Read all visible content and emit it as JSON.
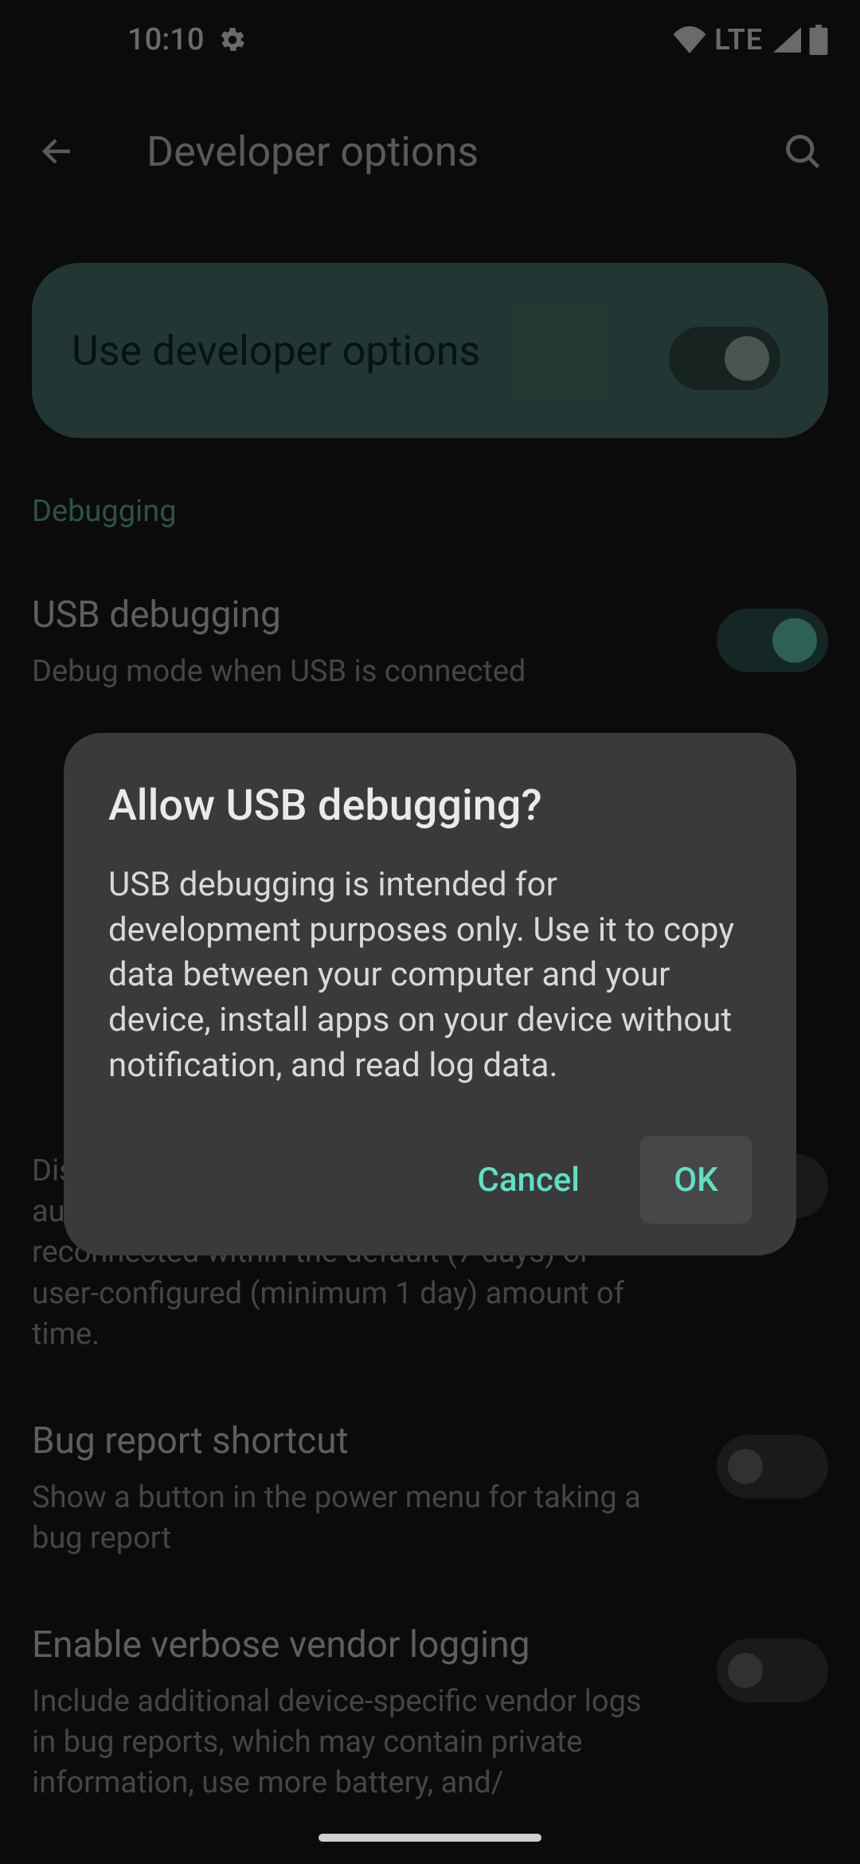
{
  "status": {
    "time": "10:10",
    "lte": "LTE"
  },
  "header": {
    "title": "Developer options"
  },
  "dev_card": {
    "label": "Use developer options",
    "toggle_on": true
  },
  "section": {
    "debugging": "Debugging"
  },
  "rows": {
    "usb_debugging": {
      "title": "USB debugging",
      "sub": "Debug mode when USB is connected",
      "toggle_on": true
    },
    "disable_adb_timeout": {
      "sub": "Disable automatic revocation of adb authorizations for systems that have not reconnected within the default (7 days) or user-configured (minimum 1 day) amount of time.",
      "toggle_on": false
    },
    "bug_report_shortcut": {
      "title": "Bug report shortcut",
      "sub": "Show a button in the power menu for taking a bug report",
      "toggle_on": false
    },
    "verbose_vendor_logging": {
      "title": "Enable verbose vendor logging",
      "sub": "Include additional device-specific vendor logs in bug reports, which may contain private information, use more battery, and/",
      "toggle_on": false
    }
  },
  "dialog": {
    "title": "Allow USB debugging?",
    "body": "USB debugging is intended for development purposes only. Use it to copy data between your computer and your device, install apps on your device without notification, and read log data.",
    "cancel": "Cancel",
    "ok": "OK"
  },
  "colors": {
    "accent": "#5fe0c4",
    "card": "#4d7a71",
    "dialog_bg": "#3a3a3a"
  }
}
